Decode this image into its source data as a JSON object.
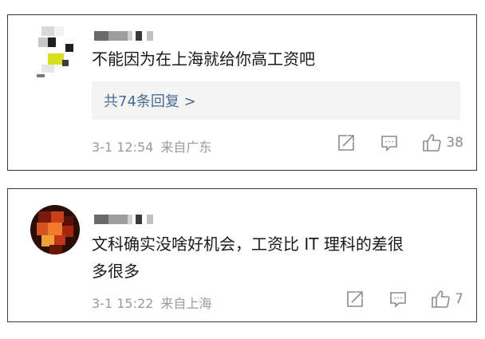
{
  "comments": [
    {
      "text": "不能因为在上海就给你高工资吧",
      "replies_label": "共74条回复 >",
      "timestamp": "3-1 12:54",
      "location": "来自广东",
      "like_count": "38"
    },
    {
      "text": "文科确实没啥好机会，工资比 IT 理科的差很\n多很多",
      "timestamp": "3-1 15:22",
      "location": "来自上海",
      "like_count": "7"
    }
  ],
  "colors": {
    "reply_link": "#4a6b94",
    "meta_text": "#9a9a9a",
    "icon": "#8c8c8c",
    "reply_bg": "#f4f4f4"
  },
  "icons": [
    "share-icon",
    "comment-icon",
    "thumbs-up-icon"
  ]
}
